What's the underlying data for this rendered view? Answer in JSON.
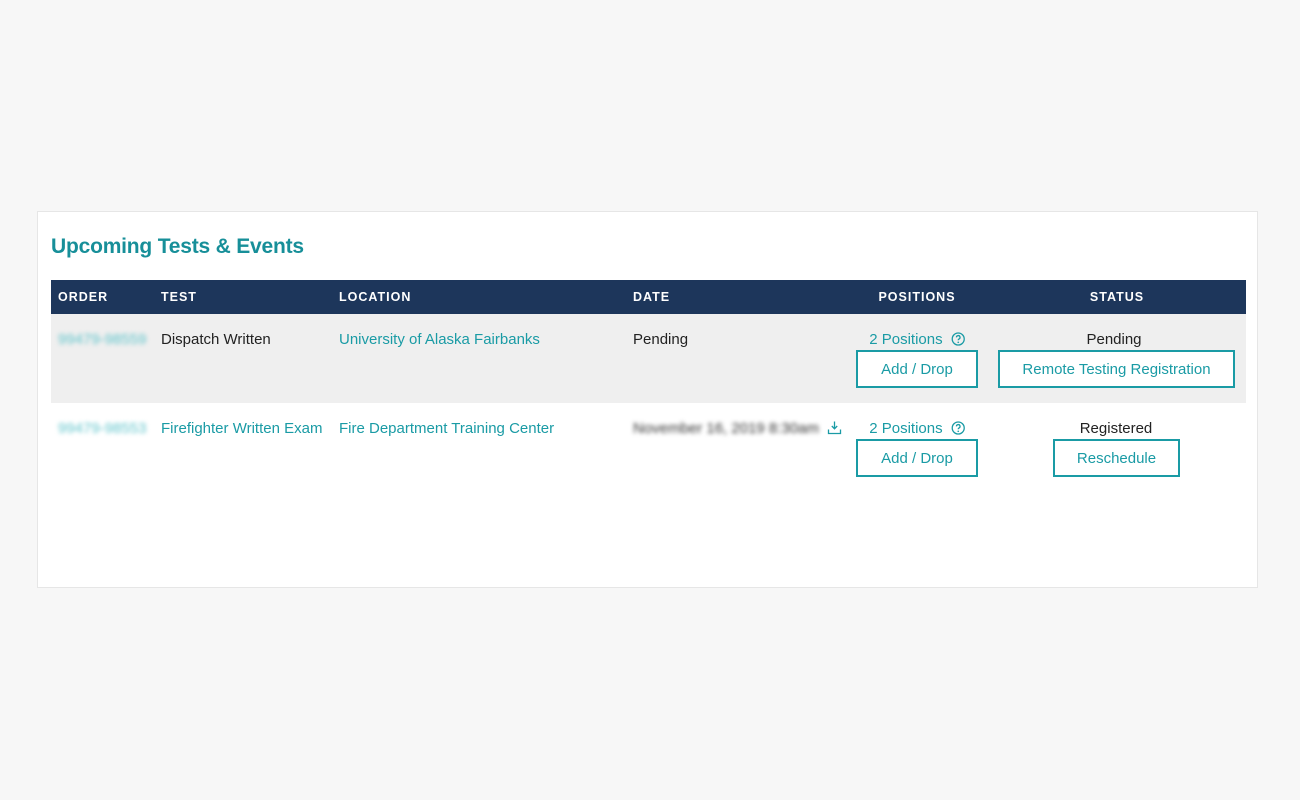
{
  "section": {
    "title": "Upcoming Tests & Events"
  },
  "table": {
    "headers": {
      "order": "ORDER",
      "test": "TEST",
      "location": "LOCATION",
      "date": "DATE",
      "positions": "POSITIONS",
      "status": "STATUS"
    },
    "rows": [
      {
        "order": "99479-98559",
        "test": "Dispatch Written",
        "location": "University of Alaska Fairbanks",
        "date": "Pending",
        "positions": "2 Positions",
        "positions_button": "Add / Drop",
        "status": "Pending",
        "status_button": "Remote Testing Registration"
      },
      {
        "order": "99479-98553",
        "test": "Firefighter Written Exam",
        "location": "Fire Department Training Center",
        "date": "November 16, 2019 8:30am",
        "positions": "2 Positions",
        "positions_button": "Add / Drop",
        "status": "Registered",
        "status_button": "Reschedule"
      }
    ]
  },
  "colors": {
    "accent": "#1a9ba5",
    "header_bg": "#1d365b",
    "title": "#178f99",
    "row_alt_bg": "#efefef",
    "page_bg": "#f7f7f7"
  },
  "icons": {
    "help": "help-circle-icon",
    "download": "download-icon"
  }
}
